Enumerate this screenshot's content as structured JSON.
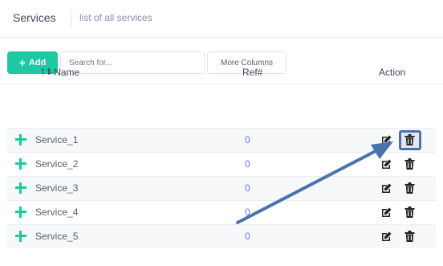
{
  "header": {
    "title": "Services",
    "subtitle": "list of all services"
  },
  "toolbar": {
    "add_label": "Add",
    "search_placeholder": "Search for...",
    "more_columns_label": "More Columns"
  },
  "table": {
    "columns": [
      "Name",
      "Ref#",
      "Action"
    ],
    "rows": [
      {
        "name": "Service_1",
        "ref": "0"
      },
      {
        "name": "Service_2",
        "ref": "0"
      },
      {
        "name": "Service_3",
        "ref": "0"
      },
      {
        "name": "Service_4",
        "ref": "0"
      },
      {
        "name": "Service_5",
        "ref": "0"
      }
    ]
  },
  "colors": {
    "accent": "#1dc9a0",
    "link": "#5d78ff",
    "annotation": "#4a73ad"
  },
  "icons": [
    "plus-icon",
    "sort-icon",
    "expand-icon",
    "edit-icon",
    "trash-icon",
    "arrow-annotation"
  ]
}
